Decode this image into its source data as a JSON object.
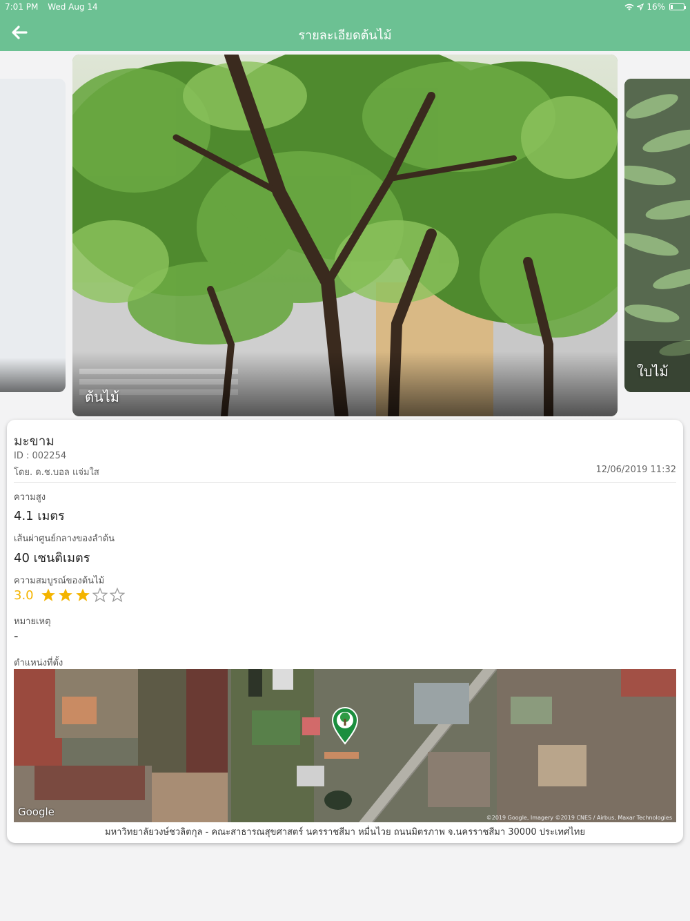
{
  "status_bar": {
    "time": "7:01 PM",
    "date": "Wed Aug 14",
    "battery": "16%"
  },
  "header": {
    "title": "รายละเอียดต้นไม้",
    "back_icon": "arrow-left-icon",
    "color": "#6cc193"
  },
  "carousel": {
    "slides": [
      {
        "caption": ""
      },
      {
        "caption": "ต้นไม้"
      },
      {
        "caption": "ใบไม้"
      }
    ]
  },
  "tree": {
    "name": "มะขาม",
    "id": "ID : 002254",
    "by": "โดย. ด.ช.บอล แจ่มใส",
    "date": "12/06/2019 11:32"
  },
  "fields": {
    "height_label": "ความสูง",
    "height_value": "4.1 เมตร",
    "diameter_label": "เส้นผ่าศูนย์กลางของลำต้น",
    "diameter_value": "40 เซนติเมตร",
    "health_label": "ความสมบูรณ์ของต้นไม้",
    "health_value": "3.0",
    "health_rating": 3,
    "health_max": 5,
    "note_label": "หมายเหตุ",
    "note_value": "-",
    "location_label": "ตำแหน่งที่ตั้ง"
  },
  "map": {
    "provider": "Google",
    "credit": "©2019 Google, Imagery ©2019 CNES / Airbus, Maxar Technologies",
    "marker_icon": "tree-marker-icon",
    "address": "มหาวิทยาลัยวงษ์ชวลิตกุล - คณะสาธารณสุขศาสตร์ นครราชสีมา หมื่นไวย ถนนมิตรภาพ จ.นครราชสีมา 30000 ประเทศไทย"
  },
  "colors": {
    "star": "#f4b400",
    "star_empty": "#999999"
  }
}
